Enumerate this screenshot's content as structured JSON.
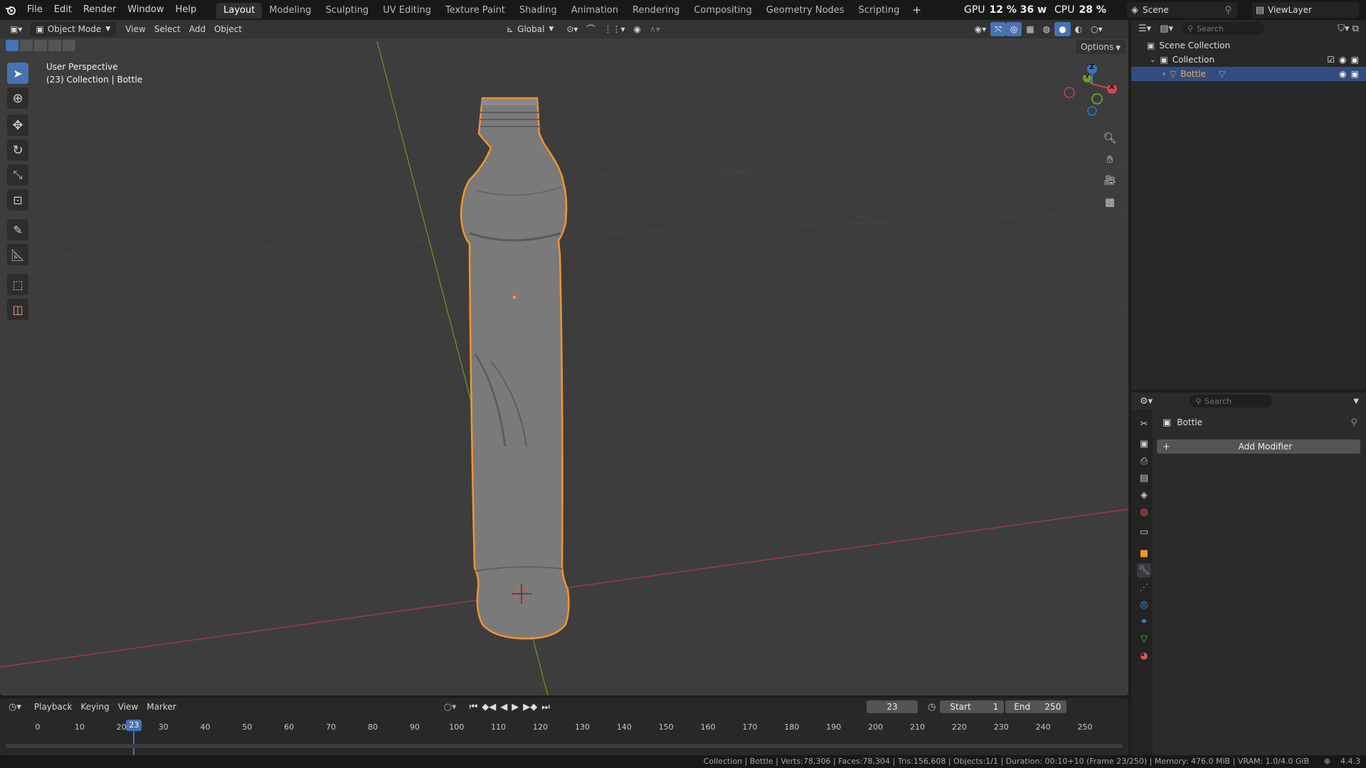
{
  "topbar": {
    "menus": [
      "File",
      "Edit",
      "Render",
      "Window",
      "Help"
    ],
    "workspaces": [
      "Layout",
      "Modeling",
      "Sculpting",
      "UV Editing",
      "Texture Paint",
      "Shading",
      "Animation",
      "Rendering",
      "Compositing",
      "Geometry Nodes",
      "Scripting"
    ],
    "active_workspace": "Layout",
    "gpu_label": "GPU",
    "gpu_value": "12 % 36 w",
    "cpu_label": "CPU",
    "cpu_value": "28 %",
    "scene": "Scene",
    "view_layer": "ViewLayer"
  },
  "viewport": {
    "mode": "Object Mode",
    "menus": [
      "View",
      "Select",
      "Add",
      "Object"
    ],
    "transform_orientation": "Global",
    "options_label": "Options",
    "overlay_title": "User Perspective",
    "overlay_subtitle": "(23) Collection | Bottle",
    "gizmo_axes": {
      "x": "X",
      "y": "Y",
      "z": "Z"
    }
  },
  "outliner": {
    "search_placeholder": "Search",
    "scene_collection": "Scene Collection",
    "collection": "Collection",
    "object": "Bottle"
  },
  "properties": {
    "search_placeholder": "Search",
    "object_name": "Bottle",
    "add_modifier": "Add Modifier"
  },
  "timeline": {
    "menus": [
      "Playback",
      "Keying",
      "View",
      "Marker"
    ],
    "current_frame": "23",
    "start_label": "Start",
    "start_value": "1",
    "end_label": "End",
    "end_value": "250",
    "ticks": [
      "0",
      "10",
      "20",
      "30",
      "40",
      "50",
      "60",
      "70",
      "80",
      "90",
      "100",
      "110",
      "120",
      "130",
      "140",
      "150",
      "160",
      "170",
      "180",
      "190",
      "200",
      "210",
      "220",
      "230",
      "240",
      "250"
    ],
    "playhead": "23"
  },
  "status": {
    "text": "Collection | Bottle | Verts:78,306 | Faces:78,304 | Tris:156,608 | Objects:1/1 | Duration: 00:10+10 (Frame 23/250) | Memory: 476.0 MiB | VRAM: 1.0/4.0 GiB",
    "version": "4.4.3"
  },
  "colors": {
    "accent": "#4772b3",
    "selection_outline": "#f0962c",
    "x_axis": "#d0444c",
    "y_axis": "#6a9a2a",
    "z_axis": "#3a73c8"
  }
}
